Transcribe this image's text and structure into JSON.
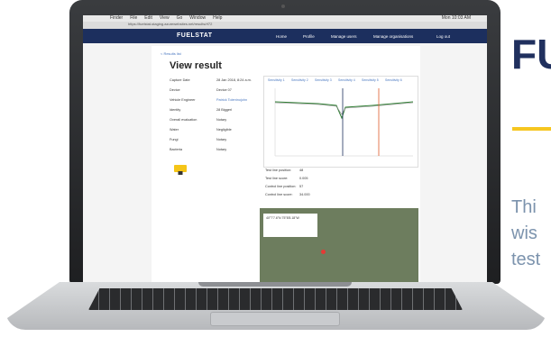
{
  "screen": {
    "menubar": [
      "Finder",
      "File",
      "Edit",
      "View",
      "Go",
      "Window",
      "Help"
    ],
    "clock": "Mon 10:03 AM",
    "url": "https://fuelstat-staging.azurewebsites.net/results/rf72",
    "logo": "FUELSTAT",
    "nav": [
      "Home",
      "Profile",
      "Manage users",
      "Manage organisations",
      "Log out"
    ],
    "breadcrumb": "< Results list",
    "page_title": "View result",
    "fields": [
      {
        "label": "Capture Date",
        "value": "28 Jan 2018, 8:24 a.m."
      },
      {
        "label": "Device",
        "value": "Device 07"
      },
      {
        "label": "Vehicle Engineer",
        "value": "Patrick Tolentnojohn"
      },
      {
        "label": "Identity",
        "value": "28 Biggerl"
      },
      {
        "label": "Overall evaluation",
        "value": "Notary"
      },
      {
        "label": "Water",
        "value": "Negligible"
      },
      {
        "label": "Fungi",
        "value": "Notary"
      },
      {
        "label": "Bacteria",
        "value": "Notary"
      }
    ],
    "tabs": [
      "Sensitivity 1",
      "Sensitivity 2",
      "Sensitivity 3",
      "Sensitivity 4",
      "Sensitivity 5",
      "Sensitivity 6"
    ],
    "test_fields": [
      {
        "label": "Test line position:",
        "value": "48"
      },
      {
        "label": "Test line score:",
        "value": "0.005"
      },
      {
        "label": "Control line position:",
        "value": "57"
      },
      {
        "label": "Control line score:",
        "value": "34.000"
      }
    ],
    "map_label": "40°7'7.6\"N 75°8'8.18\"W"
  },
  "marketing": {
    "title": "FU",
    "desc_lines": [
      "Thi",
      "wis",
      "test"
    ]
  },
  "colors": {
    "nav": "#1c2f5e",
    "accent": "#f5c518",
    "title": "#20305e",
    "desc": "#7c93ad"
  }
}
